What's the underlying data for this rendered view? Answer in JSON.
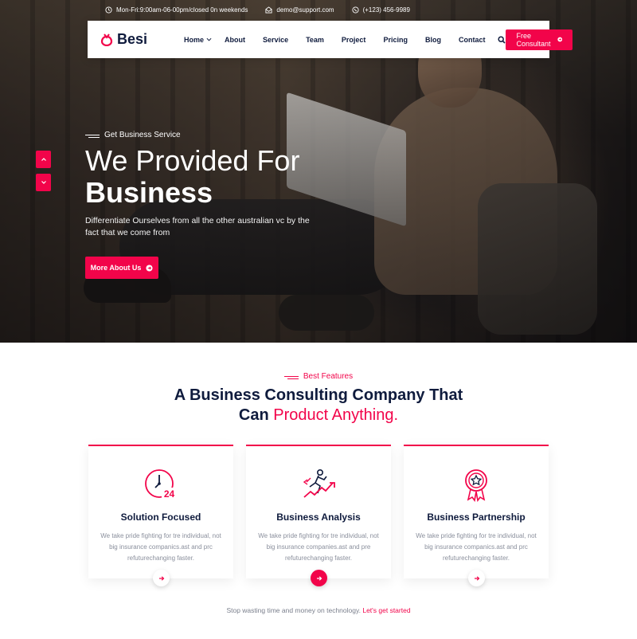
{
  "topbar": {
    "hours": "Mon-Fri:9:00am-06-00pm/closed 0n weekends",
    "email": "demo@support.com",
    "phone": "(+123) 456-9989"
  },
  "brand": {
    "name": "Besi",
    "color": "#f2044a"
  },
  "nav": {
    "items": [
      "Home",
      "About",
      "Service",
      "Team",
      "Project",
      "Pricing",
      "Blog",
      "Contact"
    ],
    "cta": "Free Consultant"
  },
  "hero": {
    "eyebrow": "Get Business Service",
    "title_line1": "We Provided For",
    "title_line2": "Business",
    "description": "Differentiate Ourselves from all the other australian vc by the fact that we come from",
    "button": "More About Us"
  },
  "features": {
    "eyebrow": "Best Features",
    "title_main": "A Business Consulting Company That",
    "title_line2_plain": "Can",
    "title_line2_accent": "Product Anything.",
    "cards": [
      {
        "icon": "clock-24-icon",
        "title": "Solution Focused",
        "text": "We take pride fighting for tre individual, not big insurance companics.ast and prc refuturechanging faster."
      },
      {
        "icon": "growth-runner-icon",
        "title": "Business Analysis",
        "text": "We take pride fighting for tre individual, not big insurance companies.ast and pre refuturechanging faster."
      },
      {
        "icon": "award-badge-icon",
        "title": "Business Partnership",
        "text": "We take pride fighting for tre individual, not big insurance companics.ast and prc refuturechanging faster."
      }
    ]
  },
  "footer_note": {
    "text": "Stop wasting time and money on technology.",
    "link": "Let's get started"
  }
}
